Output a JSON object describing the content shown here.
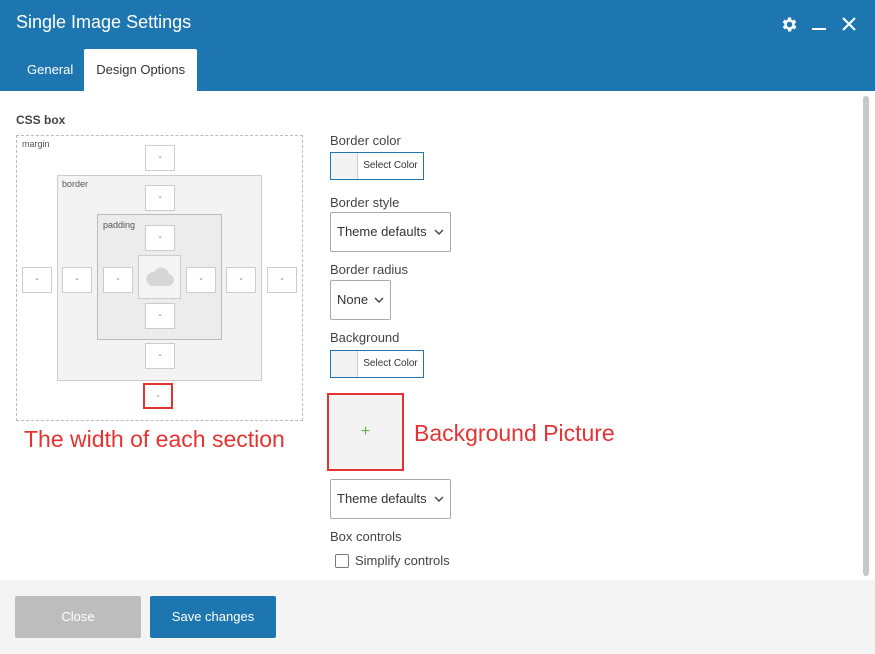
{
  "window": {
    "title": "Single Image Settings",
    "icons": [
      "gear-icon",
      "minimize-icon",
      "close-icon"
    ]
  },
  "tabs": [
    {
      "label": "General",
      "active": false
    },
    {
      "label": "Design Options",
      "active": true
    }
  ],
  "css_box": {
    "label": "CSS box",
    "margin_label": "margin",
    "border_label": "border",
    "padding_label": "padding",
    "placeholder": "-",
    "margin": {
      "top": "-",
      "right": "-",
      "bottom": "-",
      "left": "-"
    },
    "border": {
      "top": "-",
      "right": "-",
      "bottom": "-",
      "left": "-"
    },
    "padding": {
      "top": "-",
      "right": "-",
      "bottom": "-",
      "left": "-"
    }
  },
  "settings": {
    "border_color_label": "Border color",
    "border_color_button": "Select Color",
    "border_style_label": "Border style",
    "border_style_value": "Theme defaults",
    "border_radius_label": "Border radius",
    "border_radius_value": "None",
    "background_label": "Background",
    "background_color_button": "Select Color",
    "background_image_add": "+",
    "background_style_value": "Theme defaults",
    "box_controls_label": "Box controls",
    "simplify_controls_label": "Simplify controls",
    "simplify_controls_checked": false
  },
  "annotations": {
    "width_note": "The width of each section",
    "background_picture_note": "Background Picture",
    "color": "#e53333"
  },
  "footer": {
    "close_label": "Close",
    "save_label": "Save changes"
  },
  "colors": {
    "header": "#1e76b1",
    "accent": "#1e76b1",
    "close_button": "#bdbdbd",
    "add_icon": "#5fb14b"
  }
}
